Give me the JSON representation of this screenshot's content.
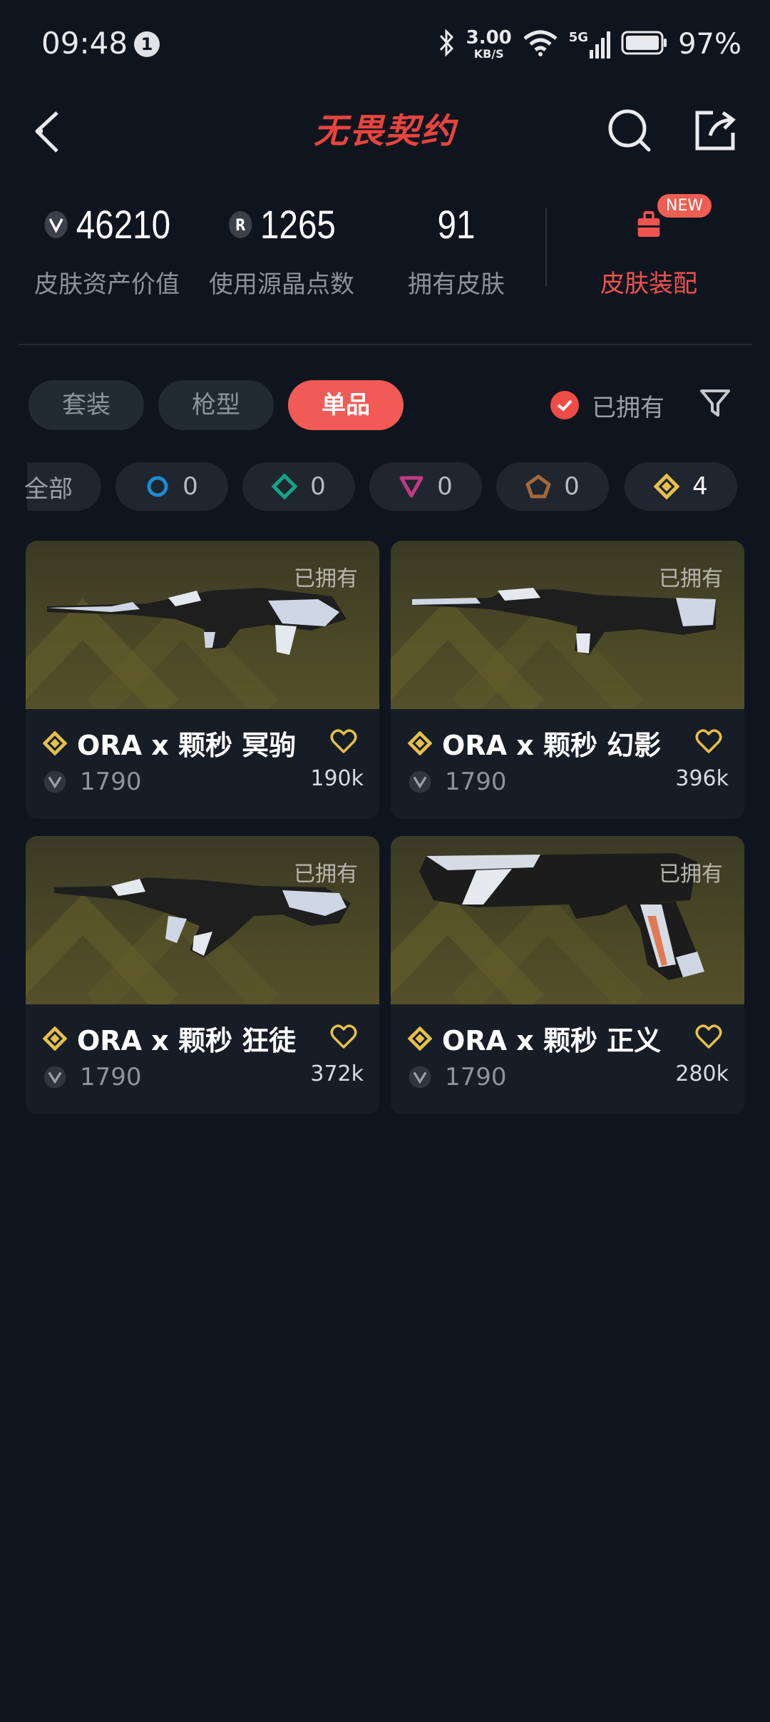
{
  "status_bar": {
    "time": "09:48",
    "notification_count": "1",
    "net_speed_value": "3.00",
    "net_speed_unit": "KB/S",
    "network_type": "5G",
    "battery": "97%"
  },
  "header": {
    "title": "无畏契约"
  },
  "stats": {
    "asset_value": "46210",
    "asset_value_label": "皮肤资产价值",
    "radianite_points": "1265",
    "radianite_points_label": "使用源晶点数",
    "owned_skins": "91",
    "owned_skins_label": "拥有皮肤",
    "equip_label": "皮肤装配",
    "new_badge": "NEW"
  },
  "tabs": [
    {
      "label": "套装",
      "active": false
    },
    {
      "label": "枪型",
      "active": false
    },
    {
      "label": "单品",
      "active": true
    }
  ],
  "owned_filter_label": "已拥有",
  "rarity_chips": [
    {
      "label": "全部"
    },
    {
      "icon": "select-tier-icon",
      "color": "#1f8ad1",
      "count": "0"
    },
    {
      "icon": "deluxe-tier-icon",
      "color": "#15a38a",
      "count": "0"
    },
    {
      "icon": "premium-tier-icon",
      "color": "#c03a86",
      "count": "0"
    },
    {
      "icon": "ultra-tier-icon",
      "color": "#a2693b",
      "count": "0"
    },
    {
      "icon": "exclusive-tier-icon",
      "color": "#e6c04a",
      "count": "4"
    }
  ],
  "cards": [
    {
      "owned": "已拥有",
      "name": "ORA x 颗秒 冥驹",
      "price": "1790",
      "likes": "190k"
    },
    {
      "owned": "已拥有",
      "name": "ORA x 颗秒 幻影",
      "price": "1790",
      "likes": "396k"
    },
    {
      "owned": "已拥有",
      "name": "ORA x 颗秒 狂徒",
      "price": "1790",
      "likes": "372k"
    },
    {
      "owned": "已拥有",
      "name": "ORA x 颗秒 正义",
      "price": "1790",
      "likes": "280k"
    }
  ],
  "colors": {
    "background": "#0f151e",
    "accent": "#f25a55",
    "gold": "#e6c04a"
  }
}
